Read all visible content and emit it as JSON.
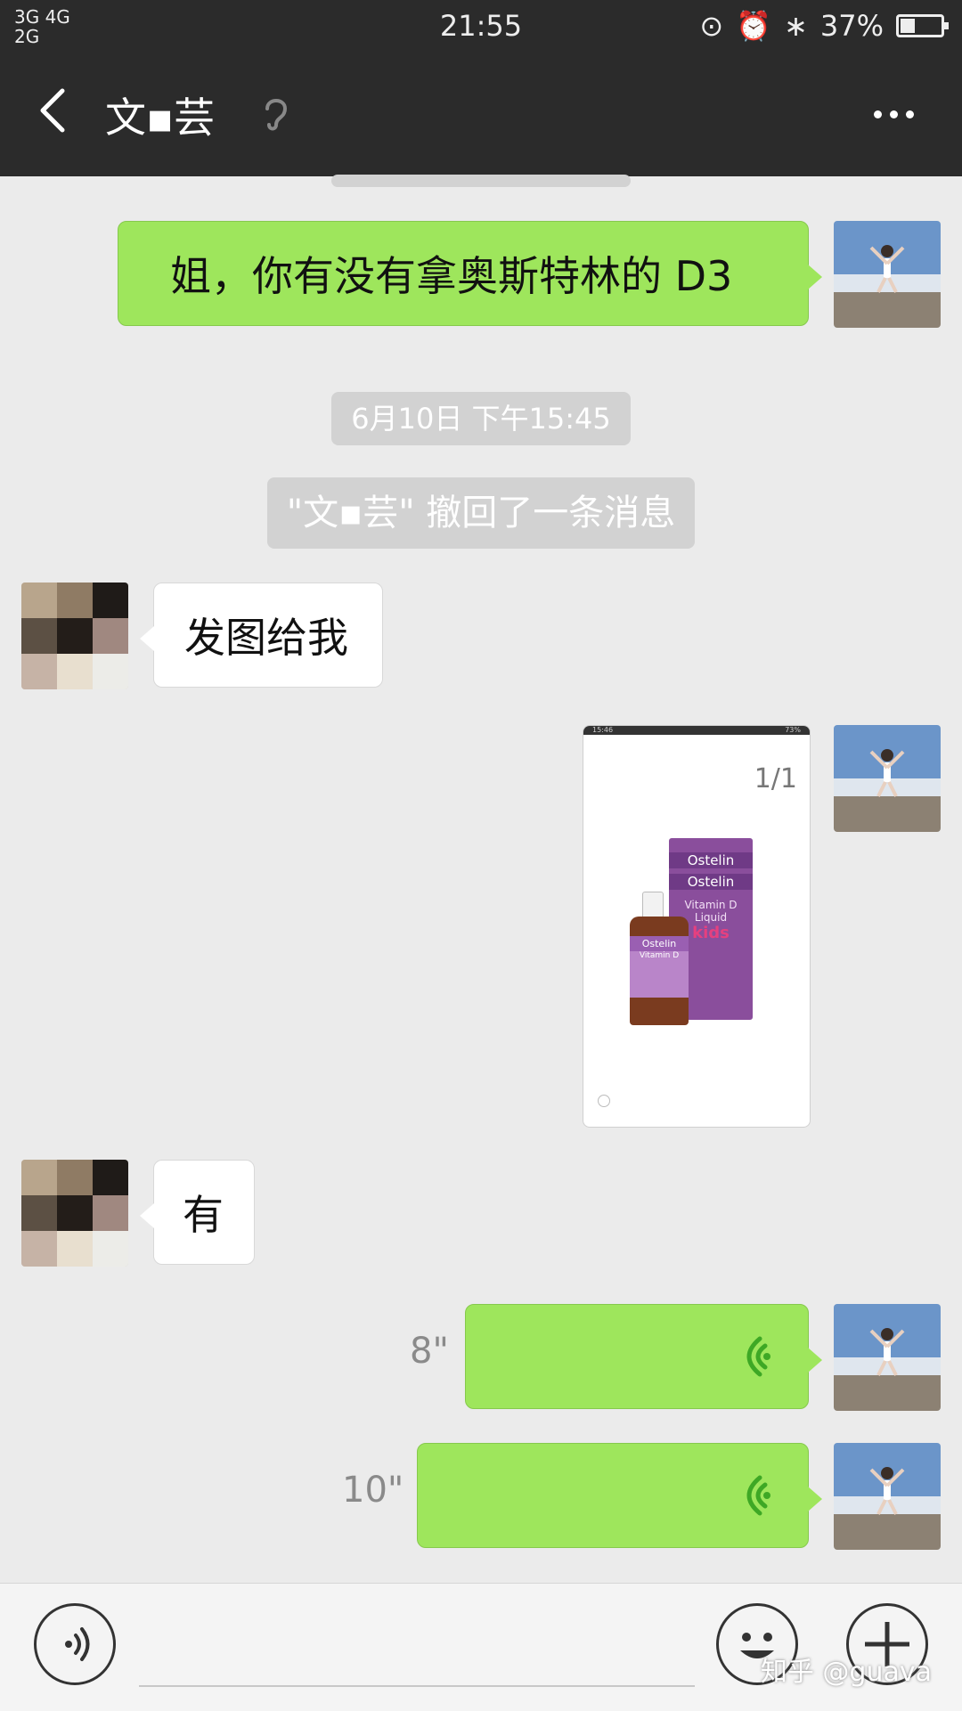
{
  "status_bar": {
    "signal_left": "3G 4G",
    "signal_left2": "2G",
    "time": "21:55",
    "battery_text": "37%",
    "battery_level": 0.37
  },
  "header": {
    "contact_name": "文▪芸",
    "more_label": "···"
  },
  "messages": {
    "m1": {
      "text": "姐，你有没有拿奥斯特林的 D3"
    },
    "timestamp": "6月10日 下午15:45",
    "recall_notice": "\"文▪芸\" 撤回了一条消息",
    "m2": {
      "text": "发图给我"
    },
    "m3": {
      "screenshot_counter": "1/1",
      "product_brand": "Ostelin",
      "product_name_1": "Vitamin D",
      "product_name_2": "Liquid",
      "product_kids": "kids",
      "mini_time": "15:46",
      "mini_battery": "73%"
    },
    "m4": {
      "text": "有"
    },
    "v1": {
      "duration": "8\""
    },
    "v2": {
      "duration": "10\""
    }
  },
  "input_bar": {
    "watermark": "知乎 @guava"
  },
  "colors": {
    "header_bg": "#2b2b2b",
    "chat_bg": "#ebebeb",
    "outgoing_bubble": "#9ee65c",
    "incoming_bubble": "#ffffff",
    "voice_icon": "#3ea825"
  }
}
